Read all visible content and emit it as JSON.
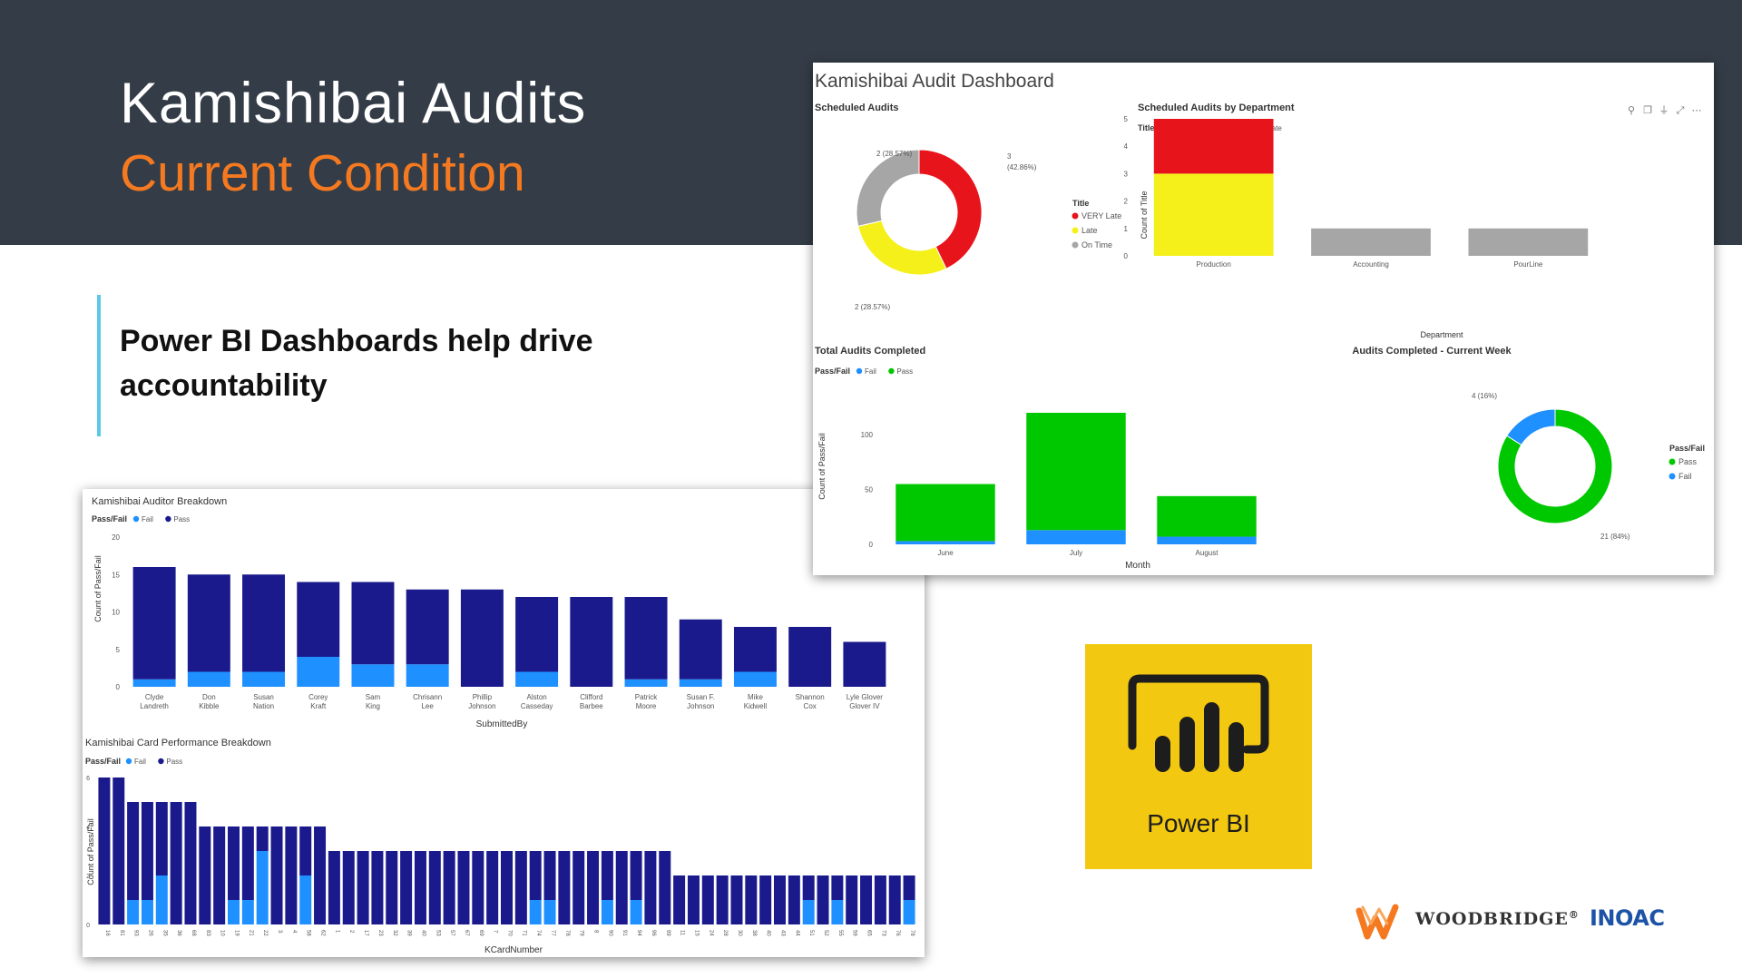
{
  "slide": {
    "title": "Kamishibai Audits",
    "subtitle": "Current Condition",
    "point": "Power BI Dashboards help drive accountability",
    "colors": {
      "banner": "#343d47",
      "subtitle": "#f47920",
      "accent_bar": "#5bc8e8"
    }
  },
  "dashboard_a": {
    "title": "Kamishibai Audit Dashboard",
    "toolbar_icons": [
      "pin-icon",
      "copy-icon",
      "filter-icon",
      "focus-icon",
      "more-icon"
    ],
    "scheduled": {
      "title": "Scheduled Audits",
      "legend_title": "Title",
      "label_top": "3",
      "label_top2": "(42.86%)",
      "label_left": "2 (28.57%)",
      "label_bottom": "2 (28.57%)"
    },
    "by_dept": {
      "title": "Scheduled Audits by Department",
      "legend_title": "Title",
      "ylabel": "Count of Title",
      "xlabel": "Department"
    },
    "completed": {
      "title": "Total Audits Completed",
      "legend_title": "Pass/Fail",
      "ylabel": "Count of Pass/Fail",
      "xlabel": "Month"
    },
    "week": {
      "title": "Audits Completed - Current Week",
      "legend_title": "Pass/Fail",
      "label_small": "4 (16%)",
      "label_large": "21 (84%)"
    }
  },
  "dashboard_b": {
    "auditor": {
      "title": "Kamishibai Auditor Breakdown",
      "legend_title": "Pass/Fail",
      "ylabel": "Count of Pass/Fail",
      "xlabel": "SubmittedBy"
    },
    "card": {
      "title": "Kamishibai Card Performance Breakdown",
      "legend_title": "Pass/Fail",
      "ylabel": "Count of Pass/Fail",
      "xlabel": "KCardNumber"
    }
  },
  "powerbi_logo": {
    "label": "Power BI",
    "tile_color": "#f2c811"
  },
  "logos": {
    "woodbridge": "WOODBRIDGE",
    "woodbridge_mark": "®",
    "inoac": "INOAC"
  },
  "chart_data": [
    {
      "id": "scheduled_audits",
      "type": "pie",
      "title": "Scheduled Audits",
      "legend_title": "Title",
      "labels": [
        "VERY Late",
        "Late",
        "On Time"
      ],
      "values": [
        3,
        2,
        2
      ],
      "percentages": [
        42.86,
        28.57,
        28.57
      ],
      "colors": [
        "#e8141c",
        "#f5f019",
        "#a6a6a6"
      ],
      "donut": true
    },
    {
      "id": "scheduled_by_department",
      "type": "bar",
      "stacked": true,
      "title": "Scheduled Audits by Department",
      "legend_title": "Title",
      "legend_labels": [
        "Late",
        "On Time",
        "VERY Late"
      ],
      "xlabel": "Department",
      "ylabel": "Count of Title",
      "categories": [
        "Production",
        "Accounting",
        "PourLine"
      ],
      "series": [
        {
          "name": "Late",
          "values": [
            3,
            0,
            0
          ],
          "color": "#f5f019"
        },
        {
          "name": "On Time",
          "values": [
            0,
            1,
            1
          ],
          "color": "#a6a6a6"
        },
        {
          "name": "VERY Late",
          "values": [
            2,
            0,
            0
          ],
          "color": "#e8141c"
        }
      ],
      "ylim": [
        0,
        5
      ],
      "yticks": [
        "0",
        "1",
        "2",
        "3",
        "4",
        "5"
      ]
    },
    {
      "id": "total_audits_completed",
      "type": "bar",
      "stacked": true,
      "title": "Total Audits Completed",
      "legend_title": "Pass/Fail",
      "legend_labels": [
        "Fail",
        "Pass"
      ],
      "xlabel": "Month",
      "ylabel": "Count of Pass/Fail",
      "categories": [
        "June",
        "July",
        "August"
      ],
      "series": [
        {
          "name": "Fail",
          "values": [
            3,
            13,
            7
          ],
          "color": "#1e90ff"
        },
        {
          "name": "Pass",
          "values": [
            52,
            107,
            37
          ],
          "color": "#00c800"
        }
      ],
      "ylim": [
        0,
        120
      ],
      "yticks": [
        "0",
        "50",
        "100"
      ]
    },
    {
      "id": "audits_current_week",
      "type": "pie",
      "title": "Audits Completed - Current Week",
      "legend_title": "Pass/Fail",
      "labels": [
        "Pass",
        "Fail"
      ],
      "values": [
        21,
        4
      ],
      "percentages": [
        84,
        16
      ],
      "colors": [
        "#00c800",
        "#1e90ff"
      ],
      "donut": true
    },
    {
      "id": "auditor_breakdown",
      "type": "bar",
      "stacked": true,
      "title": "Kamishibai Auditor Breakdown",
      "legend_title": "Pass/Fail",
      "legend_labels": [
        "Fail",
        "Pass"
      ],
      "xlabel": "SubmittedBy",
      "ylabel": "Count of Pass/Fail",
      "categories": [
        "Clyde Landreth",
        "Don Kibble",
        "Susan Nation",
        "Corey Kraft",
        "Sam King",
        "Chrisann Lee",
        "Phillip Johnson",
        "Alston Casseday",
        "Clifford Barbee",
        "Patrick Moore",
        "Susan F. Johnson",
        "Mike Kidwell",
        "Shannon Cox",
        "Lyle Glover Glover IV"
      ],
      "series": [
        {
          "name": "Fail",
          "values": [
            1,
            2,
            2,
            4,
            3,
            3,
            0,
            2,
            0,
            1,
            1,
            2,
            0,
            0
          ],
          "color": "#1e90ff"
        },
        {
          "name": "Pass",
          "values": [
            15,
            13,
            13,
            10,
            11,
            10,
            13,
            10,
            12,
            11,
            8,
            6,
            8,
            6
          ],
          "color": "#1a1a8c"
        }
      ],
      "ylim": [
        0,
        20
      ],
      "yticks": [
        "0",
        "5",
        "10",
        "15",
        "20"
      ]
    },
    {
      "id": "card_performance",
      "type": "bar",
      "stacked": true,
      "title": "Kamishibai Card Performance Breakdown",
      "legend_title": "Pass/Fail",
      "legend_labels": [
        "Fail",
        "Pass"
      ],
      "xlabel": "KCardNumber",
      "ylabel": "Count of Pass/Fail",
      "categories": [
        "16",
        "81",
        "93",
        "26",
        "35",
        "36",
        "68",
        "83",
        "10",
        "19",
        "21",
        "22",
        "3",
        "4",
        "58",
        "62",
        "1",
        "2",
        "17",
        "23",
        "32",
        "39",
        "40",
        "53",
        "57",
        "67",
        "69",
        "7",
        "70",
        "71",
        "74",
        "77",
        "78",
        "79",
        "8",
        "90",
        "91",
        "94",
        "96",
        "99",
        "11",
        "15",
        "24",
        "28",
        "30",
        "38",
        "40",
        "43",
        "44",
        "51",
        "52",
        "55",
        "59",
        "65",
        "73",
        "76",
        "78"
      ],
      "series": [
        {
          "name": "Fail",
          "values": [
            0,
            0,
            1,
            1,
            2,
            0,
            0,
            0,
            0,
            1,
            1,
            3,
            0,
            0,
            2,
            0,
            0,
            0,
            0,
            0,
            0,
            0,
            0,
            0,
            0,
            0,
            0,
            0,
            0,
            0,
            1,
            1,
            0,
            0,
            0,
            1,
            0,
            1,
            0,
            0,
            0,
            0,
            0,
            0,
            0,
            0,
            0,
            0,
            0,
            1,
            0,
            1,
            0,
            0,
            0,
            0,
            1
          ],
          "color": "#1e90ff"
        },
        {
          "name": "Pass",
          "values": [
            6,
            6,
            4,
            4,
            3,
            5,
            5,
            4,
            4,
            3,
            3,
            1,
            4,
            4,
            2,
            4,
            3,
            3,
            3,
            3,
            3,
            3,
            3,
            3,
            3,
            3,
            3,
            3,
            3,
            3,
            2,
            2,
            3,
            3,
            3,
            2,
            3,
            2,
            3,
            3,
            2,
            2,
            2,
            2,
            2,
            2,
            2,
            2,
            2,
            1,
            2,
            1,
            2,
            2,
            2,
            2,
            1
          ],
          "color": "#1a1a8c"
        }
      ],
      "ylim": [
        0,
        6
      ],
      "yticks": [
        "0",
        "2",
        "4",
        "6"
      ]
    }
  ]
}
